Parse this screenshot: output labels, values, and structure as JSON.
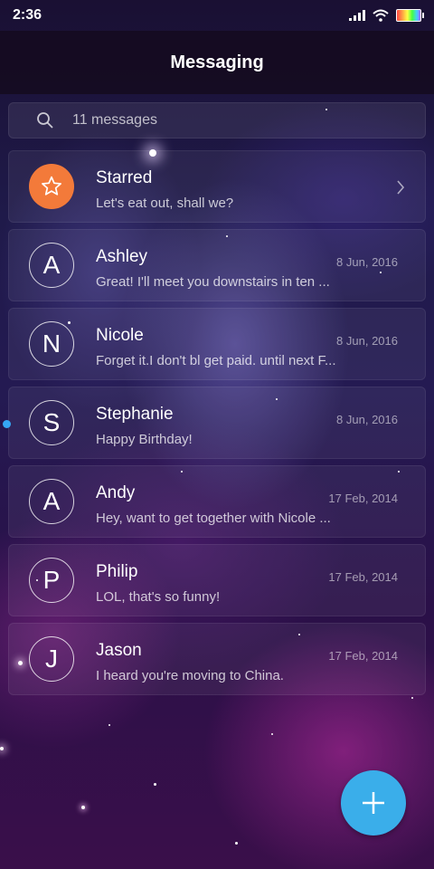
{
  "status_bar": {
    "time": "2:36"
  },
  "header": {
    "title": "Messaging"
  },
  "search": {
    "text": "11 messages"
  },
  "conversations": [
    {
      "initial": "",
      "name": "Starred",
      "preview": "Let's eat out, shall we?",
      "date": "",
      "starred": true
    },
    {
      "initial": "A",
      "name": "Ashley",
      "preview": "Great! I'll meet you downstairs in ten ...",
      "date": "8 Jun, 2016",
      "unread": false
    },
    {
      "initial": "N",
      "name": "Nicole",
      "preview": "Forget it.I don't bl get paid. until next F...",
      "date": "8 Jun, 2016",
      "unread": false
    },
    {
      "initial": "S",
      "name": "Stephanie",
      "preview": "Happy Birthday!",
      "date": "8 Jun, 2016",
      "unread": true
    },
    {
      "initial": "A",
      "name": "Andy",
      "preview": "Hey, want to get together with Nicole ...",
      "date": "17 Feb, 2014",
      "unread": false
    },
    {
      "initial": "P",
      "name": "Philip",
      "preview": "LOL, that's so funny!",
      "date": "17 Feb, 2014",
      "unread": false
    },
    {
      "initial": "J",
      "name": "Jason",
      "preview": "I heard you're moving to China.",
      "date": "17 Feb, 2014",
      "unread": false
    }
  ],
  "fab": {
    "icon": "plus-icon",
    "color": "#3aaeea"
  },
  "colors": {
    "starred_avatar": "#f37a3a",
    "unread_dot": "#35a8f5"
  }
}
